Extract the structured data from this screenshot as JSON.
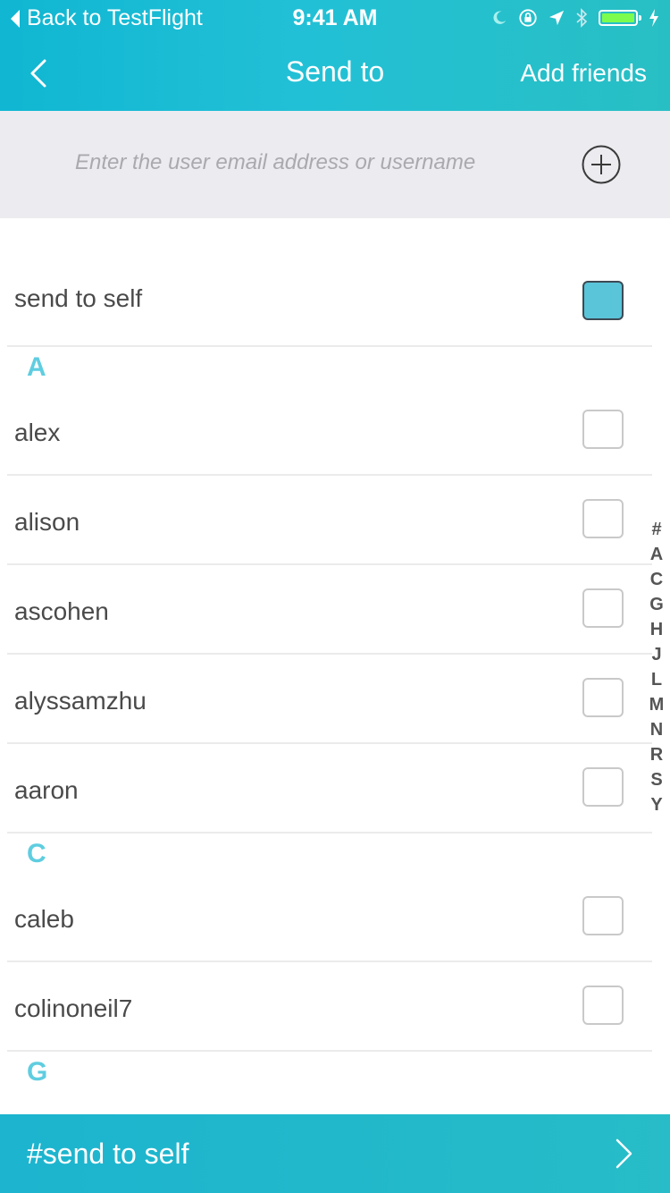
{
  "status_bar": {
    "back_label": "Back to TestFlight",
    "time": "9:41 AM",
    "icons": [
      "moon-icon",
      "rotation-lock-icon",
      "location-arrow-icon",
      "bluetooth-icon",
      "battery-icon",
      "charging-bolt-icon"
    ]
  },
  "nav": {
    "title": "Send to",
    "add_friends_label": "Add friends",
    "back_icon": "chevron-left-icon"
  },
  "search": {
    "placeholder": "Enter the user email address or username",
    "value": "",
    "add_icon": "plus-circle-icon"
  },
  "send_to_self": {
    "label": "send to self",
    "checked": true
  },
  "sections": [
    {
      "letter": "A",
      "items": [
        {
          "label": "alex",
          "checked": false
        },
        {
          "label": "alison",
          "checked": false
        },
        {
          "label": "ascohen",
          "checked": false
        },
        {
          "label": "alyssamzhu",
          "checked": false
        },
        {
          "label": "aaron",
          "checked": false
        }
      ]
    },
    {
      "letter": "C",
      "items": [
        {
          "label": "caleb",
          "checked": false
        },
        {
          "label": "colinoneil7",
          "checked": false
        }
      ]
    },
    {
      "letter": "G",
      "items": []
    }
  ],
  "index_letters": [
    "#",
    "A",
    "C",
    "G",
    "H",
    "J",
    "L",
    "M",
    "N",
    "R",
    "S",
    "Y"
  ],
  "footer": {
    "label": "#send to self",
    "chevron_icon": "chevron-right-icon"
  },
  "colors": {
    "accent": "#22c0d6",
    "section_letter": "#5fcde0",
    "checkbox_checked": "#5ac4d9",
    "battery": "#7CFC4E"
  }
}
